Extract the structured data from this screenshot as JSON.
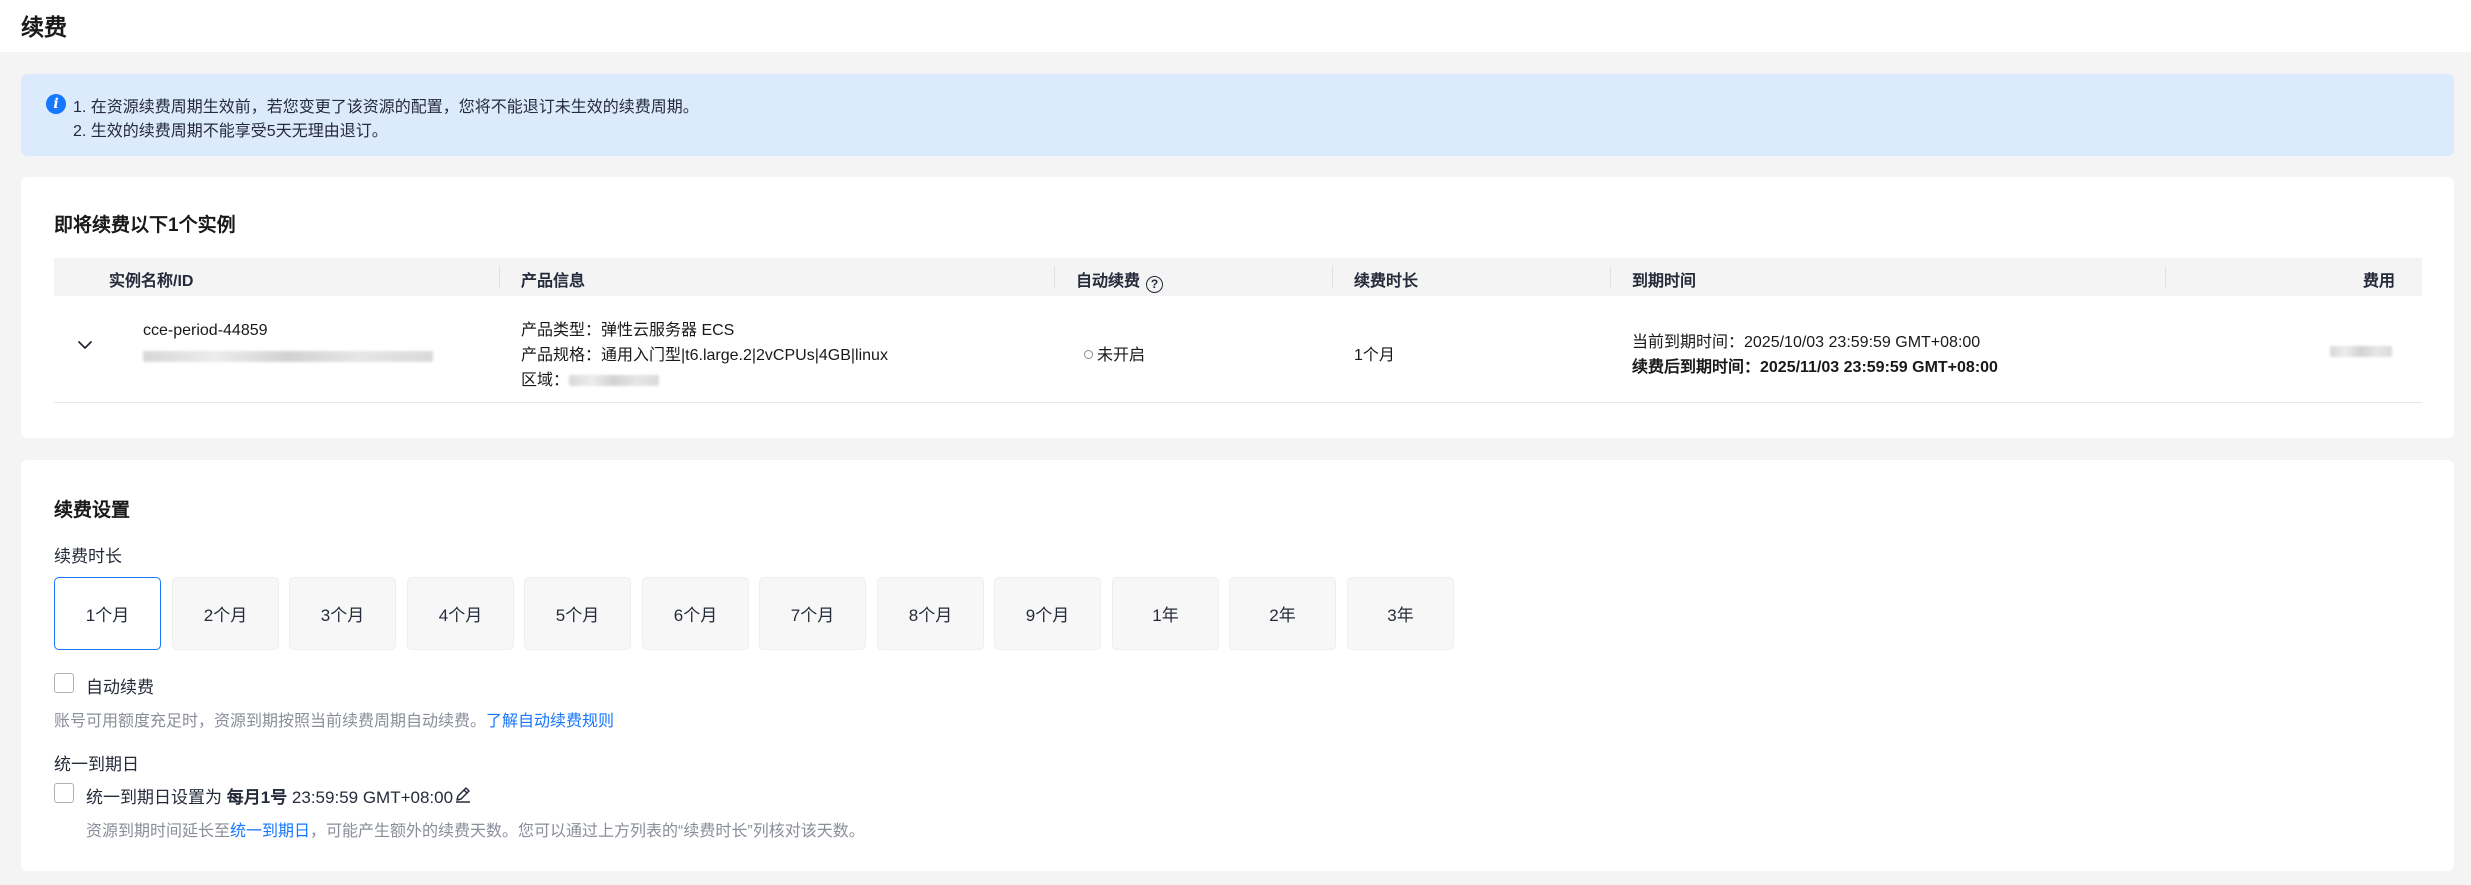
{
  "page": {
    "title": "续费"
  },
  "notice": {
    "line1": "1. 在资源续费周期生效前，若您变更了该资源的配置，您将不能退订未生效的续费周期。",
    "line2": "2. 生效的续费周期不能享受5天无理由退订。"
  },
  "instances": {
    "section_title": "即将续费以下1个实例",
    "columns": {
      "name": "实例名称/ID",
      "product": "产品信息",
      "auto_renew": "自动续费",
      "duration": "续费时长",
      "expire": "到期时间",
      "fee": "费用"
    },
    "rows": [
      {
        "name": "cce-period-44859",
        "product_type": "产品类型：弹性云服务器 ECS",
        "product_spec": "产品规格：通用入门型|t6.large.2|2vCPUs|4GB|linux",
        "region_label": "区域：",
        "auto_renew_status": "未开启",
        "duration": "1个月",
        "current_expire": "当前到期时间：2025/10/03 23:59:59 GMT+08:00",
        "new_expire": "续费后到期时间：2025/11/03 23:59:59 GMT+08:00"
      }
    ]
  },
  "settings": {
    "section_title": "续费设置",
    "duration_label": "续费时长",
    "duration_options": [
      "1个月",
      "2个月",
      "3个月",
      "4个月",
      "5个月",
      "6个月",
      "7个月",
      "8个月",
      "9个月",
      "1年",
      "2年",
      "3年"
    ],
    "selected_duration": "1个月",
    "auto_renew_label": "自动续费",
    "auto_renew_checked": false,
    "auto_renew_hint": "账号可用额度充足时，资源到期按照当前续费周期自动续费。",
    "auto_renew_link": "了解自动续费规则",
    "unified_label": "统一到期日",
    "unified_checkbox_prefix": "统一到期日设置为 ",
    "unified_day": "每月1号",
    "unified_time": " 23:59:59 GMT+08:00",
    "unified_checked": false,
    "unified_hint_prefix": "资源到期时间延长至",
    "unified_hint_link": "统一到期日",
    "unified_hint_suffix": "，可能产生额外的续费天数。您可以通过上方列表的“续费时长”列核对该天数。"
  },
  "colors": {
    "primary": "#1677ff",
    "notice_bg": "#dceafe",
    "page_bg": "#f4f4f4",
    "hint_text": "#8a8e99"
  }
}
